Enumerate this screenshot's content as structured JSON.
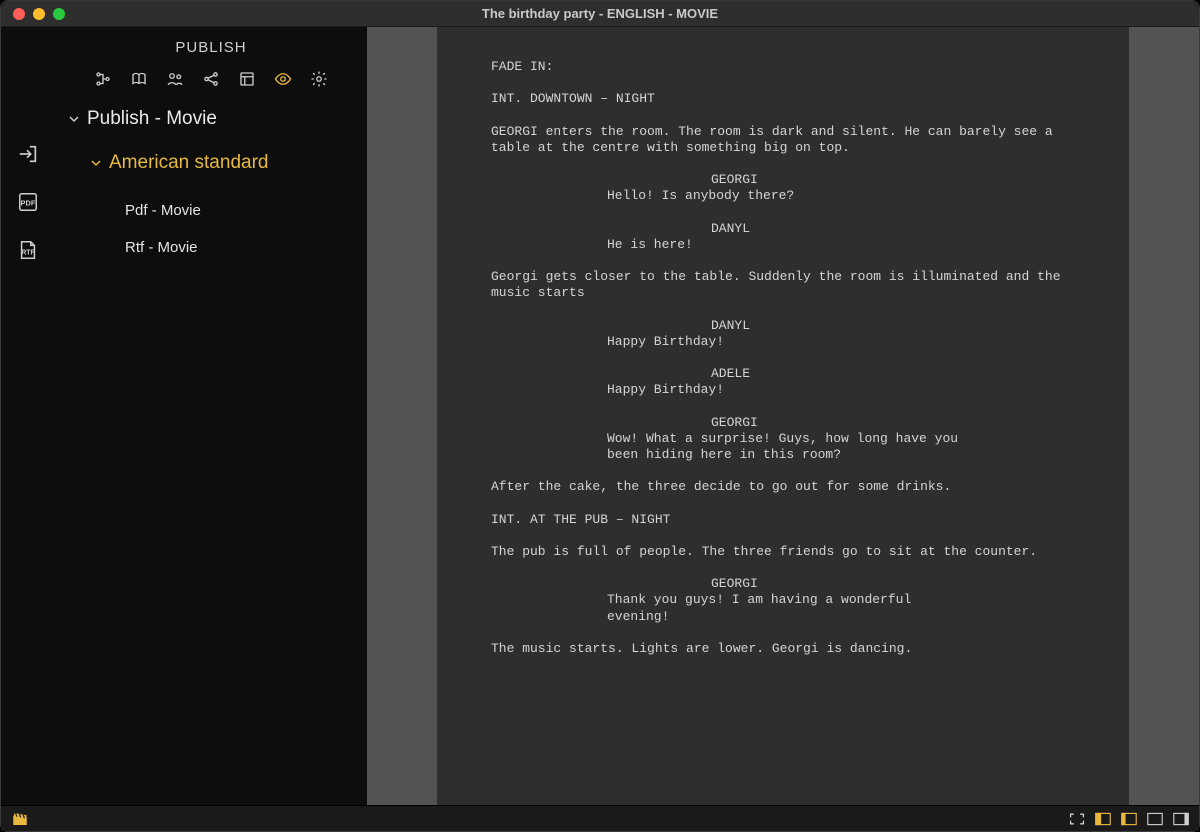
{
  "window": {
    "title": "The birthday party - ENGLISH - MOVIE"
  },
  "sidebar": {
    "title": "PUBLISH",
    "tree": {
      "root": "Publish - Movie",
      "group": "American standard",
      "items": [
        "Pdf - Movie",
        "Rtf - Movie"
      ]
    }
  },
  "colors": {
    "accent": "#e8b83f"
  },
  "script": {
    "blocks": [
      {
        "type": "action",
        "text": "FADE IN:"
      },
      {
        "type": "scene",
        "text": "INT. DOWNTOWN – NIGHT"
      },
      {
        "type": "action",
        "text": "GEORGI enters the room. The room is dark and silent. He can barely see a table at the centre with something big on top."
      },
      {
        "type": "char",
        "text": "GEORGI"
      },
      {
        "type": "dlg",
        "text": "Hello! Is anybody there?"
      },
      {
        "type": "char",
        "text": "DANYL"
      },
      {
        "type": "dlg",
        "text": "He is here!"
      },
      {
        "type": "action",
        "text": "Georgi gets closer to the table. Suddenly the room is illuminated and the music starts"
      },
      {
        "type": "char",
        "text": "DANYL"
      },
      {
        "type": "dlg",
        "text": "Happy Birthday!"
      },
      {
        "type": "char",
        "text": "ADELE"
      },
      {
        "type": "dlg",
        "text": "Happy Birthday!"
      },
      {
        "type": "char",
        "text": "GEORGI"
      },
      {
        "type": "dlg",
        "text": "Wow! What a surprise! Guys, how long have you been hiding here in this room?"
      },
      {
        "type": "action",
        "text": "After the cake, the three decide to go out for some drinks."
      },
      {
        "type": "scene",
        "text": "INT. AT THE PUB – NIGHT"
      },
      {
        "type": "action",
        "text": "The pub is full of people. The three friends go to sit at the counter."
      },
      {
        "type": "char",
        "text": "GEORGI"
      },
      {
        "type": "dlg",
        "text": "Thank you guys! I am having a wonderful evening!"
      },
      {
        "type": "action",
        "text": "The music starts. Lights are lower. Georgi is dancing."
      }
    ]
  }
}
